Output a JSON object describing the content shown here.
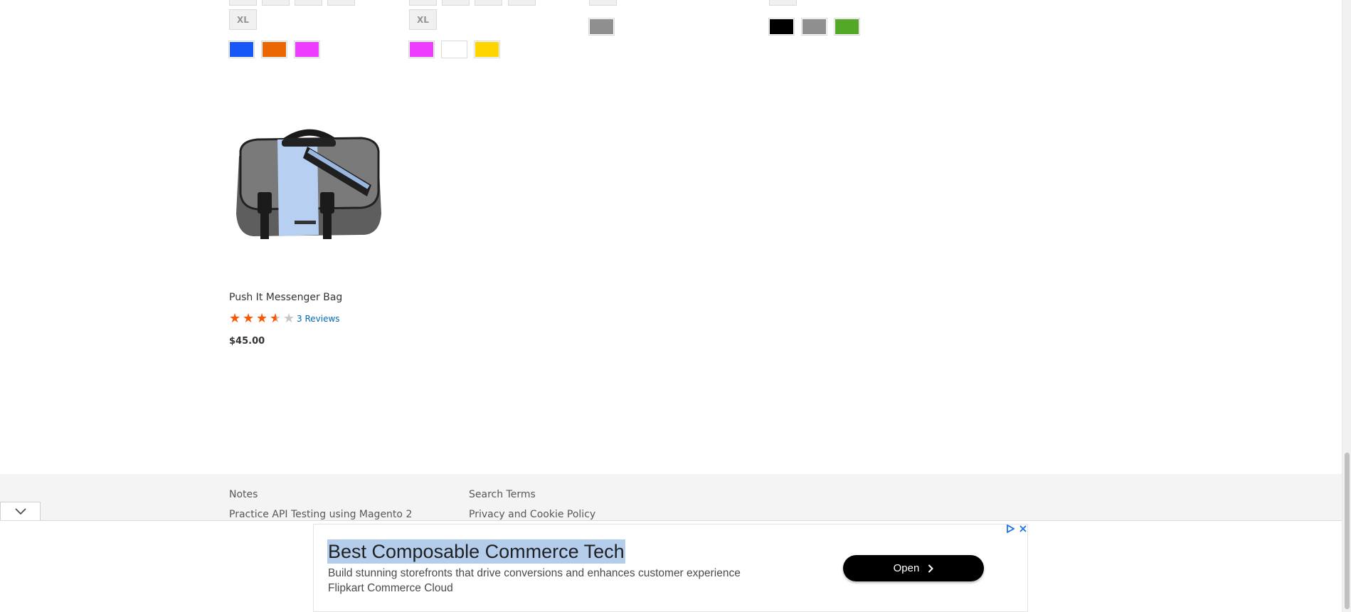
{
  "product_grid_top": {
    "columns": [
      {
        "size_label": "XL",
        "colors": [
          "#1857f7",
          "#eb6703",
          "#ef3dff"
        ]
      },
      {
        "size_label": "XL",
        "colors": [
          "#ef3dff",
          "#ffffff",
          "#ffd500"
        ]
      },
      {
        "colors": [
          "#8f8f8f"
        ]
      },
      {
        "colors": [
          "#000000",
          "#8f8f8f",
          "#53a828"
        ]
      }
    ]
  },
  "product": {
    "name": "Push It Messenger Bag",
    "rating_percent": 65,
    "reviews_label": "3 Reviews",
    "price": "$45.00",
    "image_icon": "messenger-bag-image"
  },
  "footer": {
    "links_col1": [
      "Notes",
      "Practice API Testing using Magento 2"
    ],
    "links_col2": [
      "Search Terms",
      "Privacy and Cookie Policy"
    ]
  },
  "ad": {
    "title": "Best Composable Commerce Tech",
    "description": "Build stunning storefronts that drive conversions and enhances customer experience",
    "sponsor": "Flipkart Commerce Cloud",
    "cta_label": "Open",
    "accent": "#000000"
  },
  "colors": {
    "star_filled": "#ff5501",
    "star_empty": "#c7c7c7",
    "link": "#006bb4",
    "footer_bg": "#f4f4f4"
  }
}
